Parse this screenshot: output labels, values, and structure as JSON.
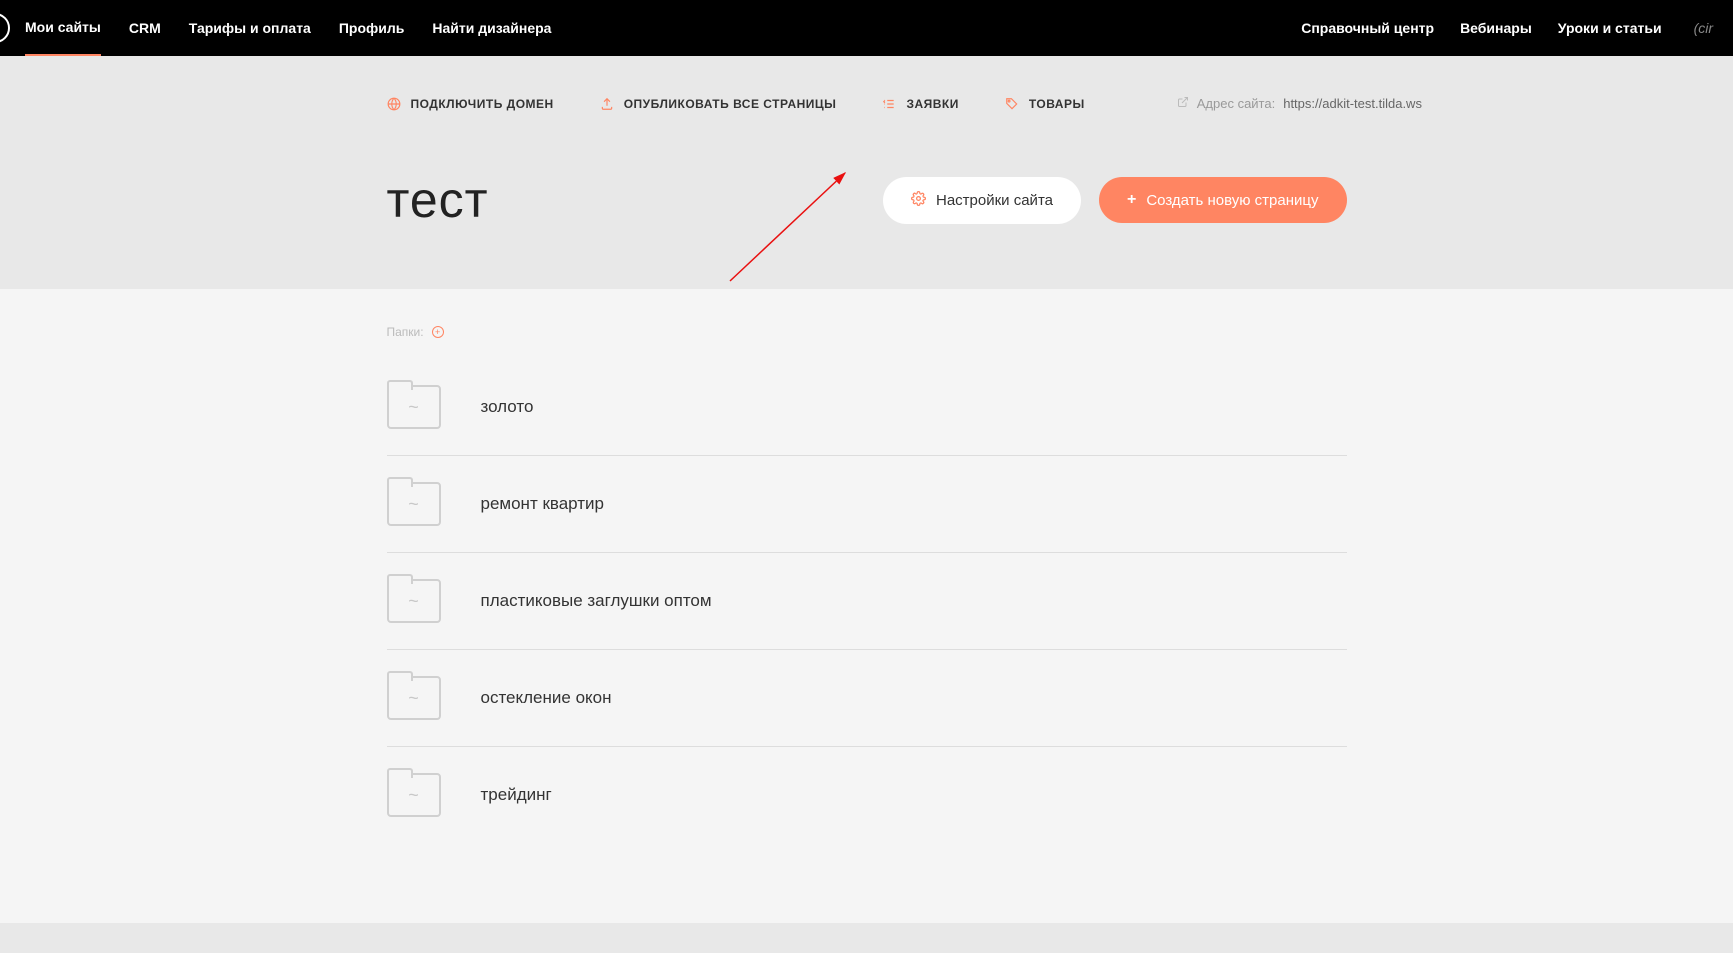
{
  "topnav": {
    "left": [
      "Мои сайты",
      "CRM",
      "Тарифы и оплата",
      "Профиль",
      "Найти дизайнера"
    ],
    "right": [
      "Справочный центр",
      "Вебинары",
      "Уроки и статьи"
    ],
    "status_partial": "(cir"
  },
  "toolbar": {
    "domain": "ПОДКЛЮЧИТЬ ДОМЕН",
    "publish": "ОПУБЛИКОВАТЬ ВСЕ СТРАНИЦЫ",
    "leads": "ЗАЯВКИ",
    "products": "ТОВАРЫ",
    "url_label": "Адрес сайта:",
    "url_value": "https://adkit-test.tilda.ws"
  },
  "hero": {
    "title": "тест",
    "settings_btn": "Настройки сайта",
    "create_btn": "Создать новую страницу"
  },
  "folders": {
    "label": "Папки:",
    "items": [
      "золото",
      "ремонт квартир",
      "пластиковые заглушки оптом",
      "остекление окон",
      "трейдинг"
    ]
  }
}
